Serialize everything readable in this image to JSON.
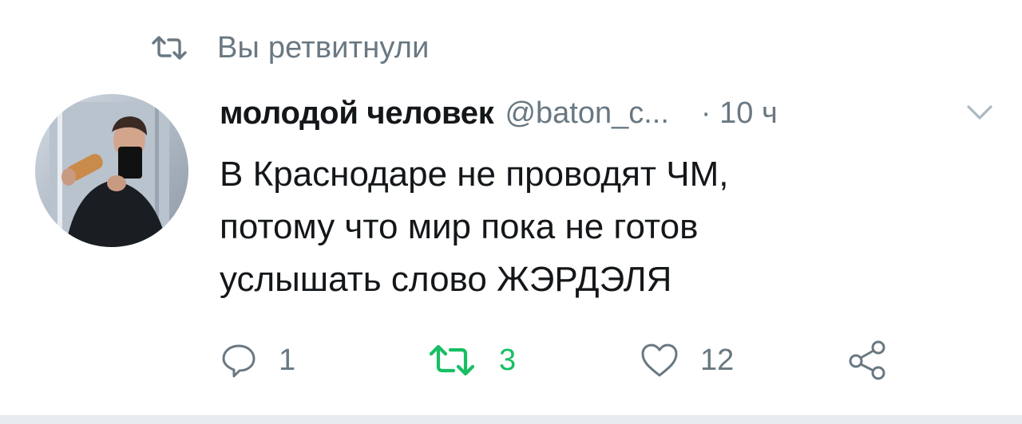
{
  "retweet_context": {
    "text": "Вы ретвитнули",
    "icon": "retweet-icon"
  },
  "tweet": {
    "author": {
      "display_name": "молодой человек",
      "handle": "@baton_c..."
    },
    "separator": "·",
    "time": "10 ч",
    "text_lines": [
      "В Краснодаре не проводят ЧМ,",
      "потому что мир пока не готов",
      "услышать слово ЖЭРДЭЛЯ"
    ],
    "actions": {
      "reply": {
        "icon": "reply-icon",
        "count": "1"
      },
      "retweet": {
        "icon": "retweet-icon",
        "count": "3",
        "active": true
      },
      "like": {
        "icon": "heart-icon",
        "count": "12"
      },
      "share": {
        "icon": "share-icon"
      }
    }
  },
  "colors": {
    "text_primary": "#14171a",
    "text_secondary": "#697882",
    "retweet_active": "#17bf63",
    "divider": "#e6ecf0"
  }
}
